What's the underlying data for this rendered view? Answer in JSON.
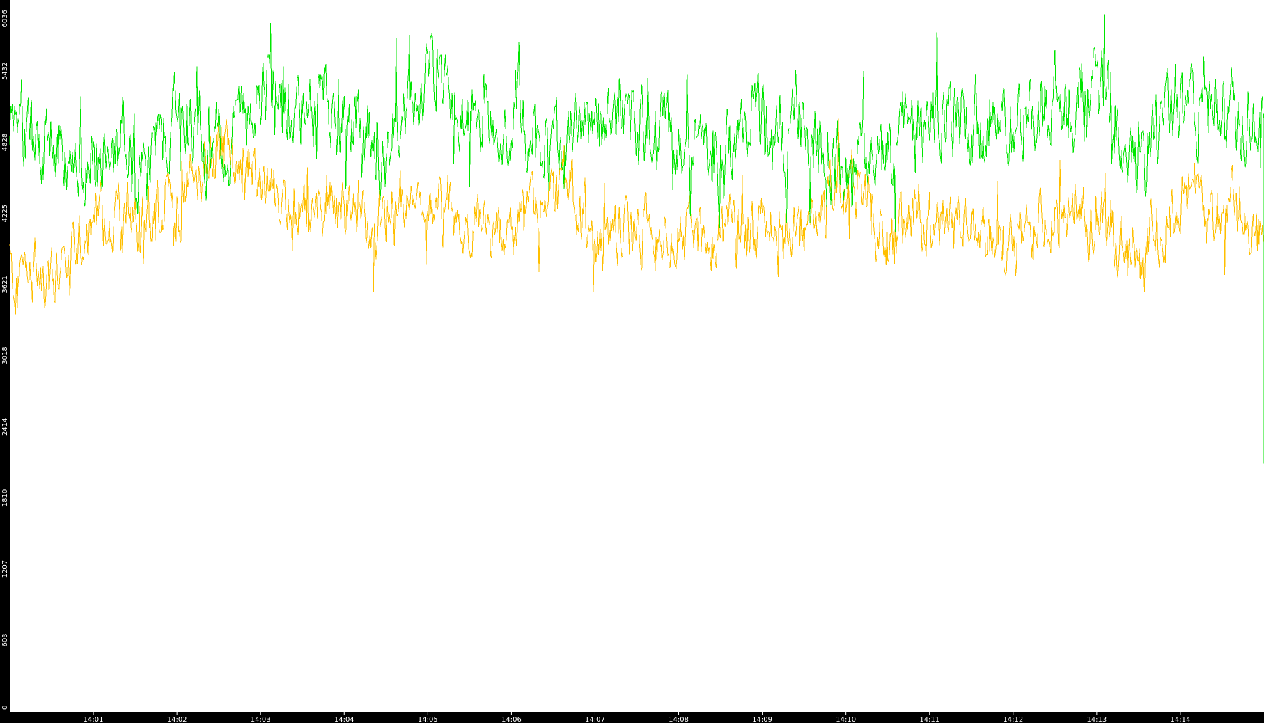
{
  "chart_data": {
    "type": "line",
    "title": "",
    "xlabel": "",
    "ylabel": "",
    "ylim": [
      0,
      6036
    ],
    "xlim": [
      "14:00",
      "14:15"
    ],
    "yticks": [
      0,
      603,
      1207,
      1810,
      2414,
      3018,
      3621,
      4225,
      4828,
      5432,
      6036
    ],
    "xticks": [
      "14:01",
      "14:02",
      "14:03",
      "14:04",
      "14:05",
      "14:06",
      "14:07",
      "14:08",
      "14:09",
      "14:10",
      "14:11",
      "14:12",
      "14:13",
      "14:14"
    ],
    "grid": false,
    "legend": "none",
    "background": "#000000",
    "plot_background": "#ffffff",
    "series": [
      {
        "color": "#00e600",
        "baseline": [
          {
            "t": "14:00:00",
            "v": 5000
          },
          {
            "t": "14:00:30",
            "v": 4900
          },
          {
            "t": "14:01:00",
            "v": 4550
          },
          {
            "t": "14:01:30",
            "v": 4700
          },
          {
            "t": "14:02:00",
            "v": 5000
          },
          {
            "t": "14:02:30",
            "v": 4750
          },
          {
            "t": "14:03:00",
            "v": 5300
          },
          {
            "t": "14:03:30",
            "v": 5100
          },
          {
            "t": "14:04:00",
            "v": 5000
          },
          {
            "t": "14:04:30",
            "v": 4750
          },
          {
            "t": "14:05:00",
            "v": 5400
          },
          {
            "t": "14:05:30",
            "v": 5000
          },
          {
            "t": "14:06:00",
            "v": 5100
          },
          {
            "t": "14:06:30",
            "v": 4800
          },
          {
            "t": "14:07:00",
            "v": 5000
          },
          {
            "t": "14:07:30",
            "v": 4900
          },
          {
            "t": "14:08:00",
            "v": 4950
          },
          {
            "t": "14:08:30",
            "v": 4700
          },
          {
            "t": "14:09:00",
            "v": 5000
          },
          {
            "t": "14:09:30",
            "v": 4900
          },
          {
            "t": "14:10:00",
            "v": 4500
          },
          {
            "t": "14:10:30",
            "v": 4800
          },
          {
            "t": "14:11:00",
            "v": 5000
          },
          {
            "t": "14:11:30",
            "v": 5050
          },
          {
            "t": "14:12:00",
            "v": 5000
          },
          {
            "t": "14:12:30",
            "v": 5050
          },
          {
            "t": "14:13:00",
            "v": 5350
          },
          {
            "t": "14:13:30",
            "v": 4600
          },
          {
            "t": "14:14:00",
            "v": 5200
          },
          {
            "t": "14:14:30",
            "v": 5100
          },
          {
            "t": "14:15:00",
            "v": 4800
          }
        ],
        "amplitude": 280,
        "last_value": 2100
      },
      {
        "color": "#ffbf00",
        "baseline": [
          {
            "t": "14:00:00",
            "v": 3750
          },
          {
            "t": "14:00:30",
            "v": 3650
          },
          {
            "t": "14:01:00",
            "v": 4150
          },
          {
            "t": "14:01:30",
            "v": 4200
          },
          {
            "t": "14:02:00",
            "v": 4250
          },
          {
            "t": "14:02:30",
            "v": 4800
          },
          {
            "t": "14:03:00",
            "v": 4500
          },
          {
            "t": "14:03:30",
            "v": 4250
          },
          {
            "t": "14:04:00",
            "v": 4300
          },
          {
            "t": "14:04:30",
            "v": 4200
          },
          {
            "t": "14:05:00",
            "v": 4400
          },
          {
            "t": "14:05:30",
            "v": 4150
          },
          {
            "t": "14:06:00",
            "v": 4050
          },
          {
            "t": "14:06:30",
            "v": 4500
          },
          {
            "t": "14:07:00",
            "v": 4050
          },
          {
            "t": "14:07:30",
            "v": 4100
          },
          {
            "t": "14:08:00",
            "v": 4000
          },
          {
            "t": "14:08:30",
            "v": 4050
          },
          {
            "t": "14:09:00",
            "v": 4100
          },
          {
            "t": "14:09:30",
            "v": 4000
          },
          {
            "t": "14:10:00",
            "v": 4600
          },
          {
            "t": "14:10:30",
            "v": 4100
          },
          {
            "t": "14:11:00",
            "v": 4200
          },
          {
            "t": "14:11:30",
            "v": 4100
          },
          {
            "t": "14:12:00",
            "v": 4000
          },
          {
            "t": "14:12:30",
            "v": 4250
          },
          {
            "t": "14:13:00",
            "v": 4150
          },
          {
            "t": "14:13:30",
            "v": 3750
          },
          {
            "t": "14:14:00",
            "v": 4350
          },
          {
            "t": "14:14:30",
            "v": 4200
          },
          {
            "t": "14:15:00",
            "v": 4150
          }
        ],
        "amplitude": 230,
        "last_value": 4150
      }
    ]
  }
}
